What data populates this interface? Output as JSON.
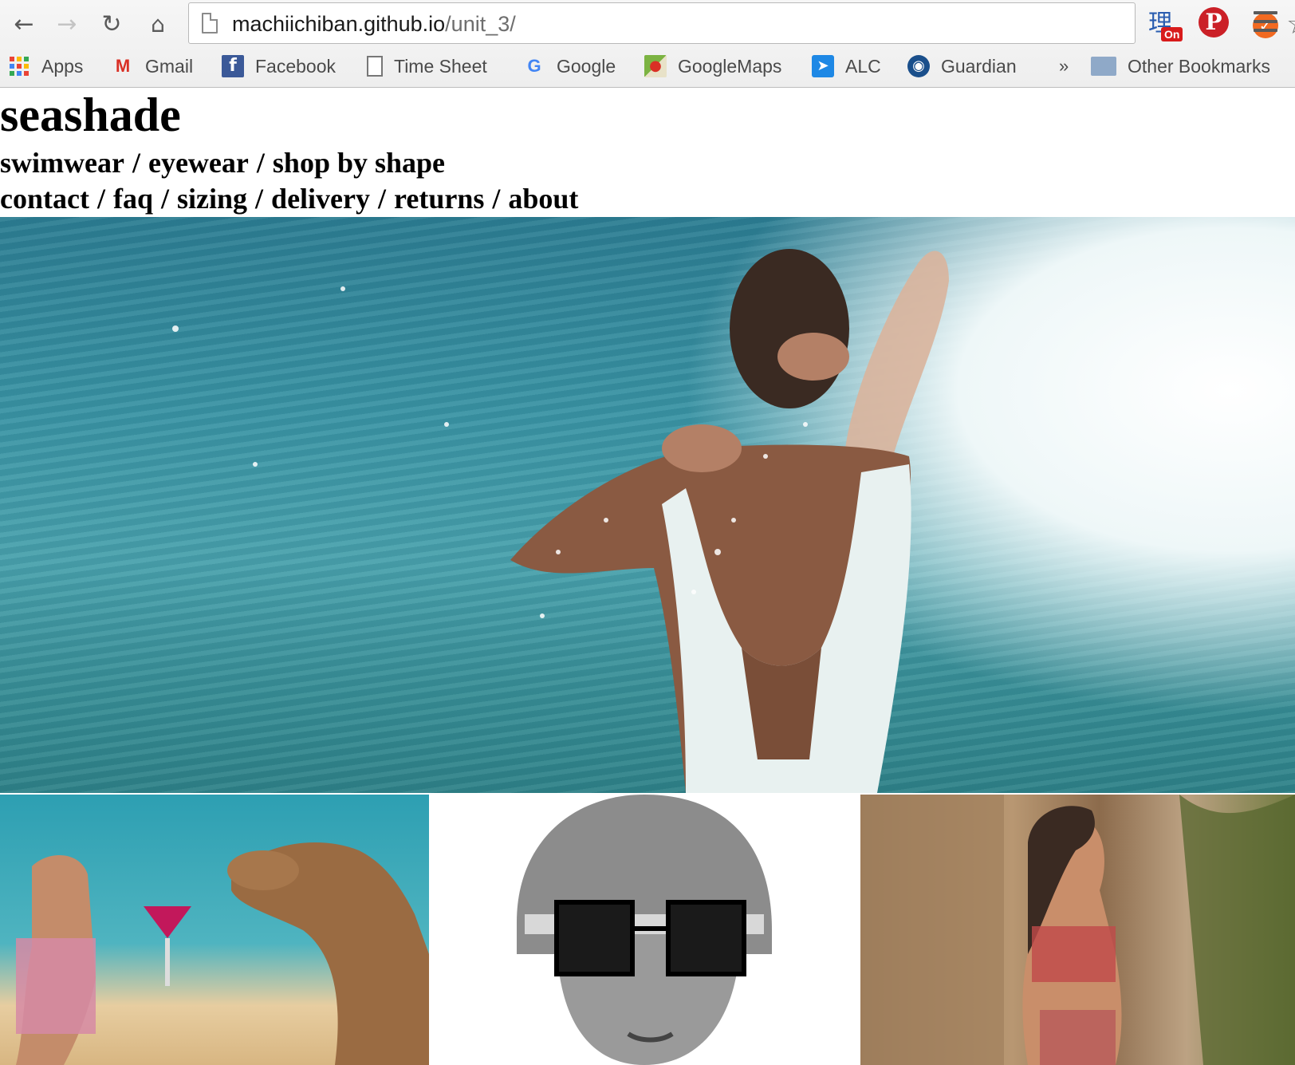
{
  "browser": {
    "url_host": "machiichiban.github.io",
    "url_path": "/unit_3/",
    "extension_badge": "On",
    "extension_glyph": "理",
    "bookmarks": [
      {
        "label": "Apps",
        "icon": "apps-grid-icon"
      },
      {
        "label": "Gmail",
        "icon": "gmail-icon"
      },
      {
        "label": "Facebook",
        "icon": "facebook-icon"
      },
      {
        "label": "Time Sheet",
        "icon": "document-icon"
      },
      {
        "label": "Google",
        "icon": "google-icon"
      },
      {
        "label": "GoogleMaps",
        "icon": "google-maps-icon"
      },
      {
        "label": "ALC",
        "icon": "alc-icon"
      },
      {
        "label": "Guardian",
        "icon": "guardian-icon"
      }
    ],
    "overflow_chevron": "»",
    "other_bookmarks": "Other Bookmarks"
  },
  "site": {
    "title": "seashade",
    "nav_primary": [
      "swimwear",
      "eyewear",
      "shop by shape"
    ],
    "nav_secondary": [
      "contact",
      "faq",
      "sizing",
      "delivery",
      "returns",
      "about"
    ],
    "separator": "/"
  },
  "colors": {
    "accent_text": "#000000",
    "chrome_bg": "#eeeeee",
    "sea": "#3b95a5"
  }
}
